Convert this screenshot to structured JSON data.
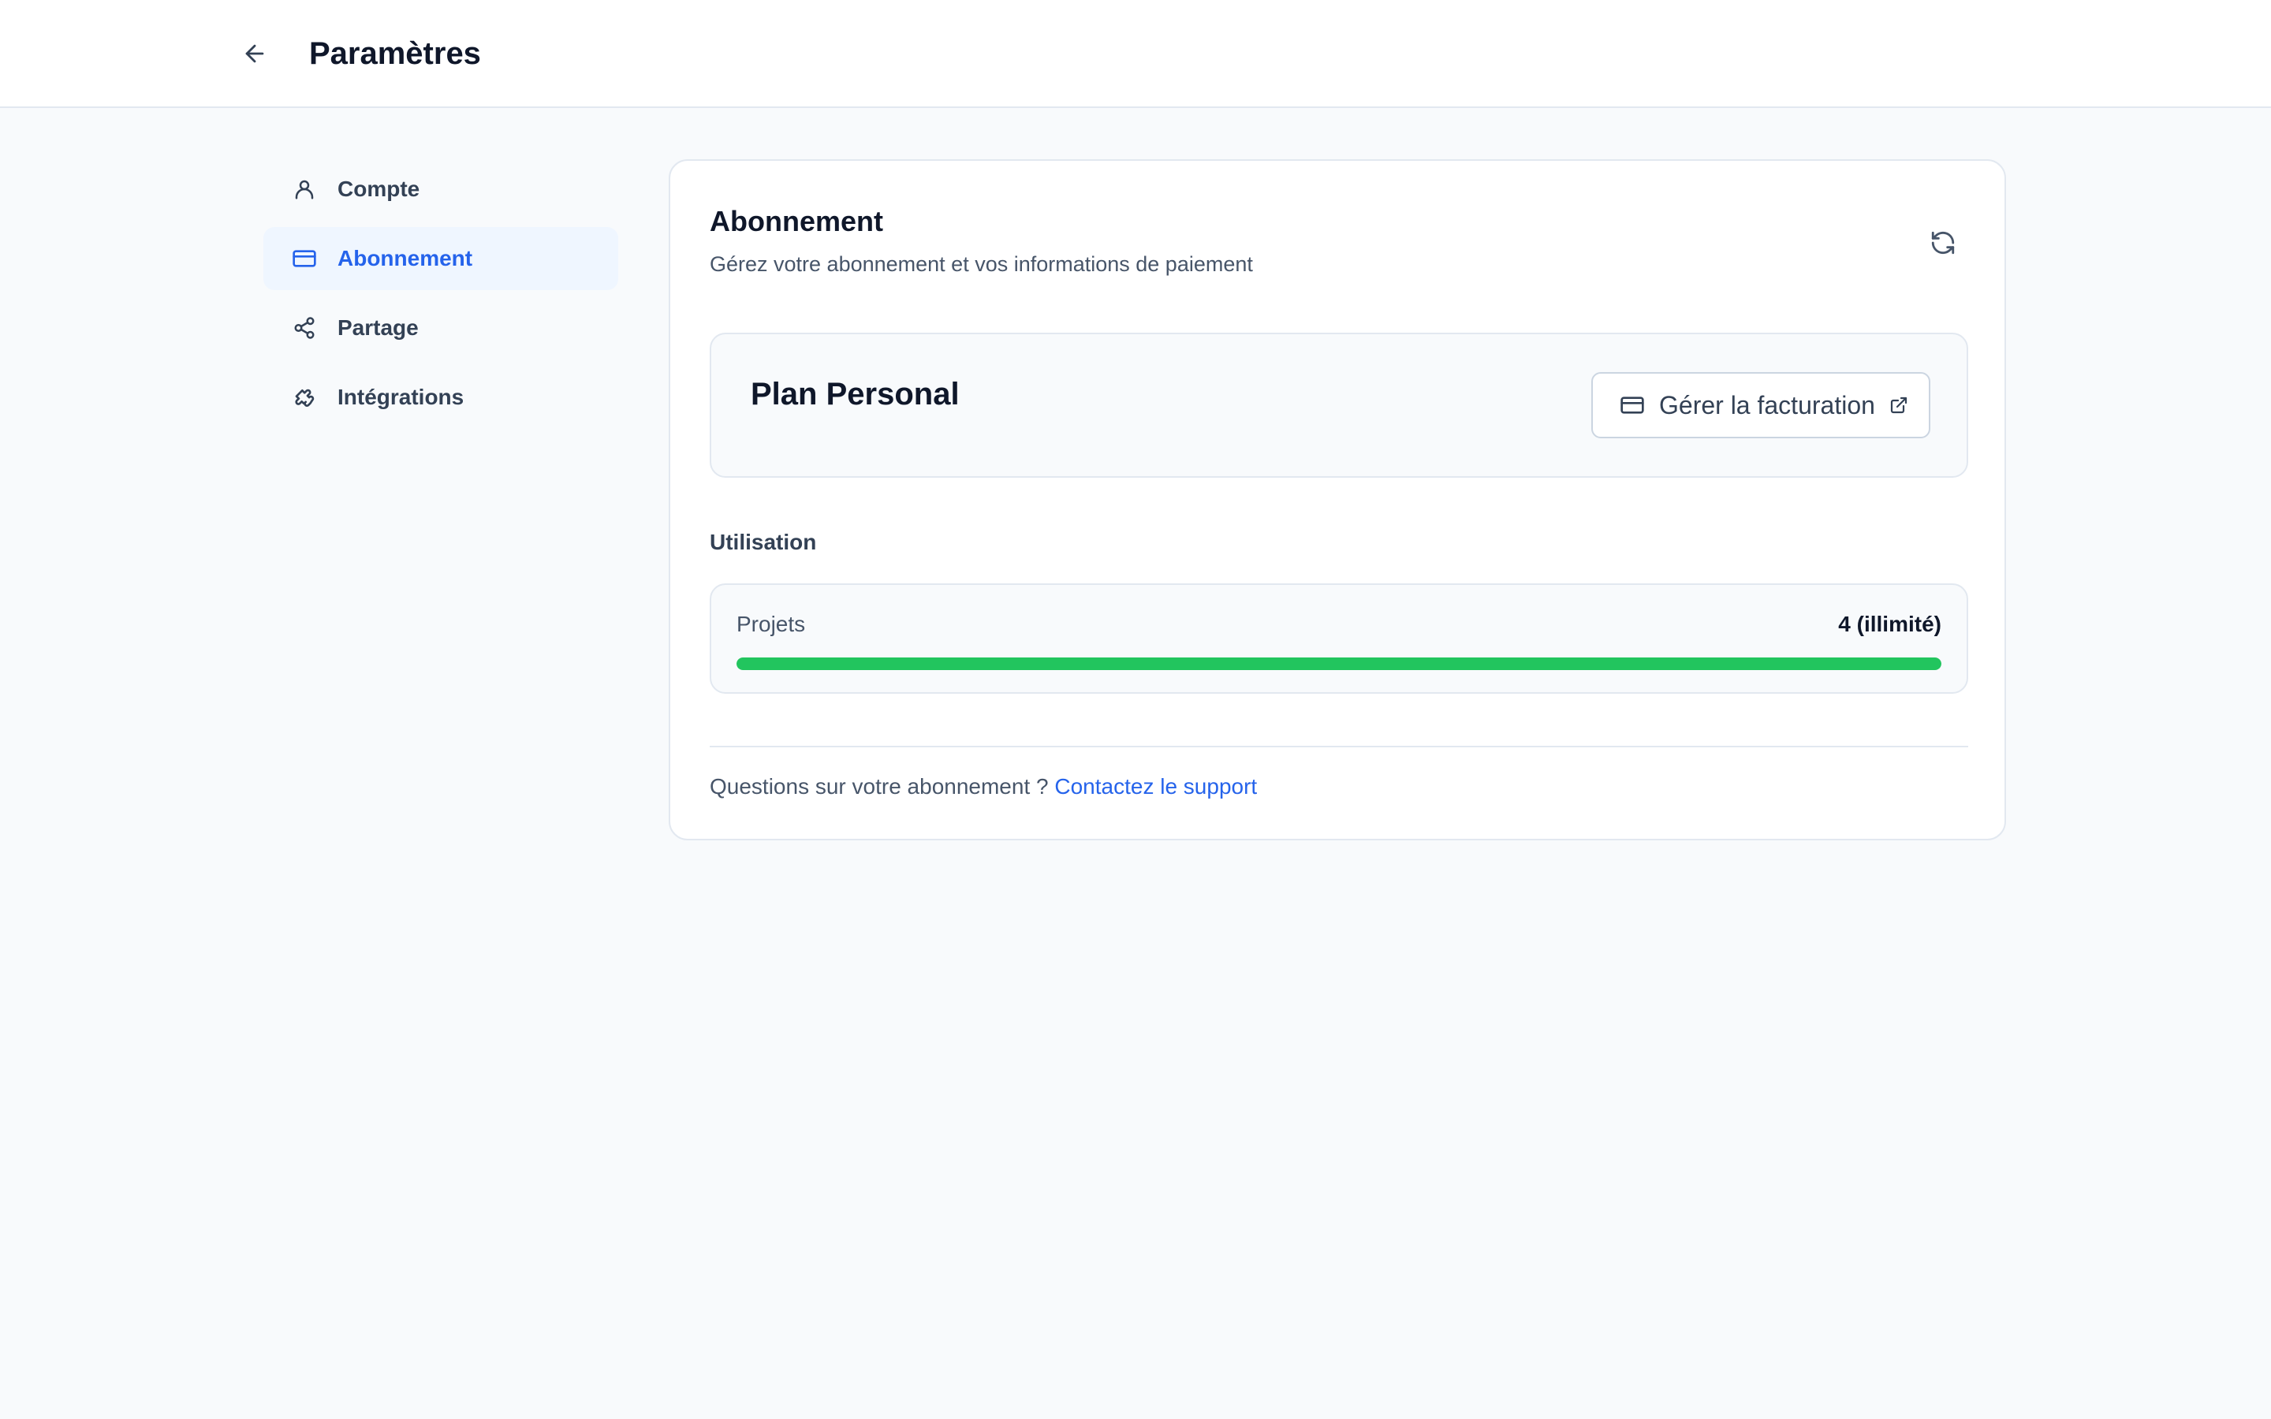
{
  "header": {
    "back_icon": "arrow-left-icon",
    "title": "Paramètres"
  },
  "sidebar": {
    "items": [
      {
        "label": "Compte",
        "icon": "user-icon",
        "active": false
      },
      {
        "label": "Abonnement",
        "icon": "credit-card-icon",
        "active": true
      },
      {
        "label": "Partage",
        "icon": "share-icon",
        "active": false
      },
      {
        "label": "Intégrations",
        "icon": "puzzle-icon",
        "active": false
      }
    ]
  },
  "subscription": {
    "title": "Abonnement",
    "subtitle": "Gérez votre abonnement et vos informations de paiement",
    "refresh_icon": "refresh-icon",
    "plan": {
      "name": "Plan Personal",
      "billing_button_label": "Gérer la facturation",
      "billing_icon": "credit-card-icon",
      "external_icon": "external-link-icon"
    },
    "usage": {
      "title": "Utilisation",
      "items": [
        {
          "label": "Projets",
          "value": "4 (illimité)",
          "progress_percent": 100
        }
      ]
    },
    "footer": {
      "text": "Questions sur votre abonnement ? ",
      "link_label": "Contactez le support"
    }
  },
  "colors": {
    "accent": "#2563eb",
    "progress": "#22c55e",
    "active_nav_bg": "#eff6ff"
  }
}
